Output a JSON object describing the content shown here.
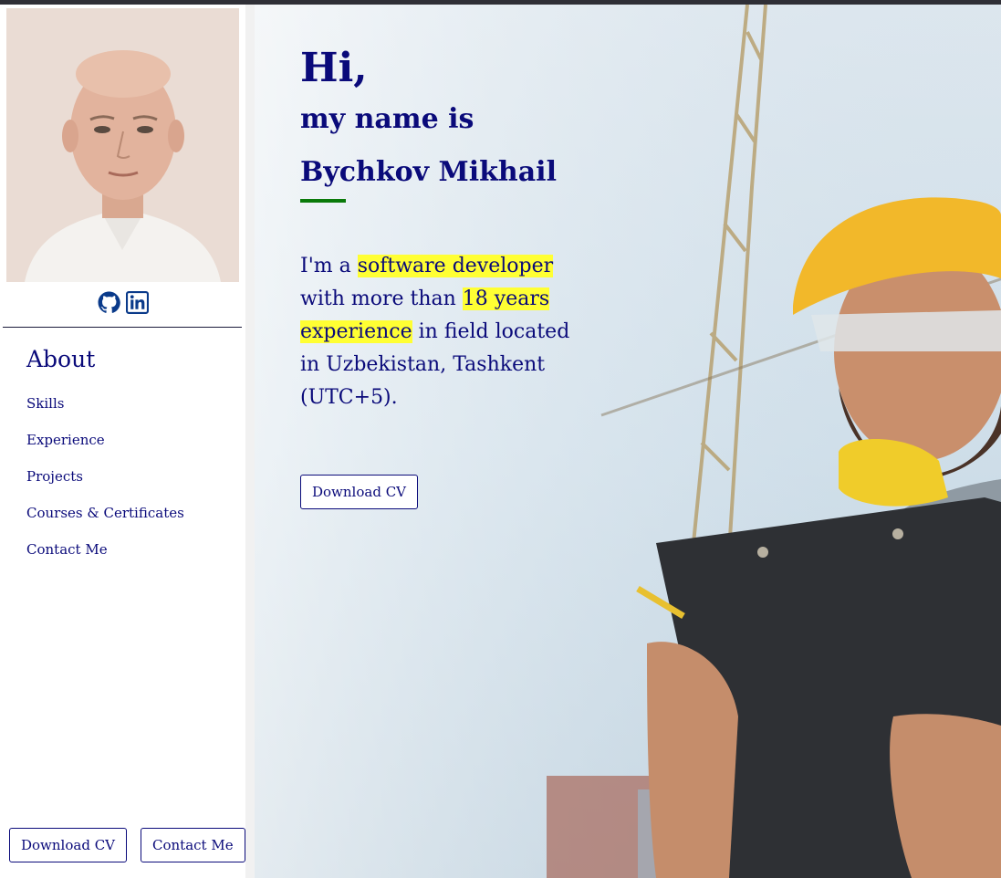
{
  "profile": {
    "photo_alt": "Profile photo",
    "social": [
      {
        "icon": "github-icon"
      },
      {
        "icon": "linkedin-icon"
      }
    ]
  },
  "nav": {
    "title": "About",
    "items": [
      {
        "label": "Skills"
      },
      {
        "label": "Experience"
      },
      {
        "label": "Projects"
      },
      {
        "label": "Courses & Certificates"
      },
      {
        "label": "Contact Me"
      }
    ]
  },
  "sidebar_buttons": {
    "download": "Download CV",
    "contact": "Contact Me"
  },
  "hero": {
    "greeting": "Hi,",
    "intro": "my name is",
    "name": "Bychkov Mikhail",
    "bio": {
      "p1": "I'm a ",
      "hl1": "software developer",
      "p2": " with more than ",
      "hl2": "18 years experience",
      "p3": " in field located in Uzbekistan, Tashkent (UTC+5)."
    },
    "download_button": "Download CV"
  },
  "colors": {
    "text": "#0a0a7a",
    "accent_underline": "#0a7a0a",
    "highlight": "#ffff33",
    "topbar": "#2f2f36"
  }
}
